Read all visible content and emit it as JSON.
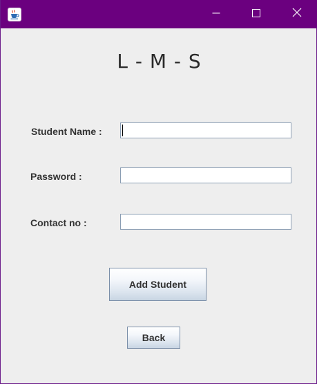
{
  "window": {
    "title": "",
    "icons": {
      "app": "java-cup-icon",
      "minimize": "minimize-icon",
      "maximize": "maximize-icon",
      "close": "close-icon"
    },
    "colors": {
      "titlebar": "#6b007f",
      "background": "#eeeeee"
    }
  },
  "form": {
    "heading": "L - M - S",
    "fields": {
      "student_name": {
        "label": "Student Name :",
        "value": ""
      },
      "password": {
        "label": "Password :",
        "value": ""
      },
      "contact_no": {
        "label": "Contact no :",
        "value": ""
      }
    },
    "buttons": {
      "add_student": "Add Student",
      "back": "Back"
    }
  }
}
